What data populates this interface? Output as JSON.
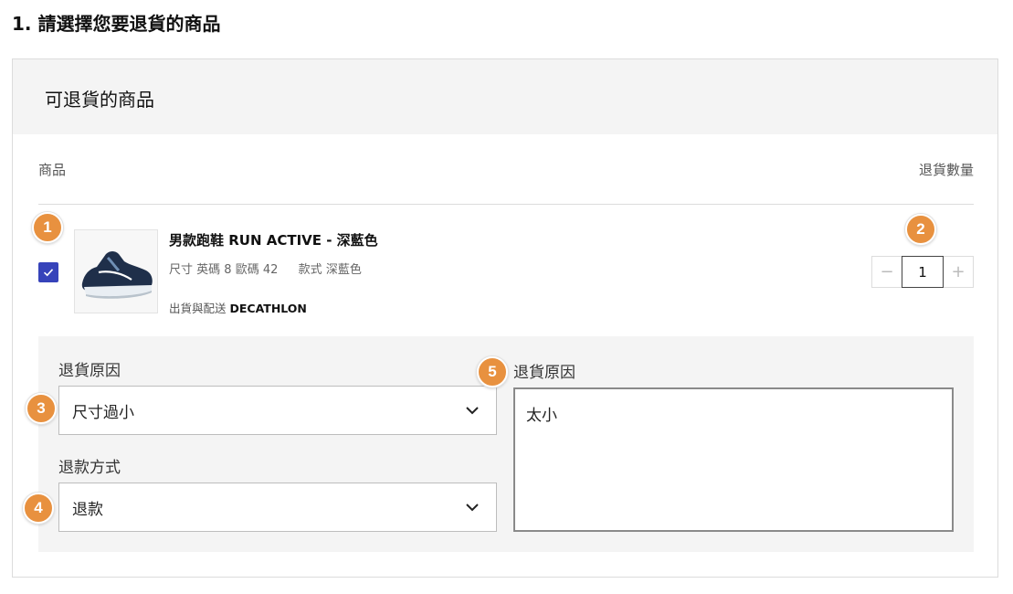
{
  "page": {
    "step_title": "1. 請選擇您要退貨的商品"
  },
  "card": {
    "title": "可退貨的商品",
    "column_product": "商品",
    "column_quantity": "退貨數量"
  },
  "item": {
    "checked": true,
    "name": "男款跑鞋 RUN ACTIVE - 深藍色",
    "size_label": "尺寸",
    "size_value": "英碼 8 歐碼 42",
    "style_label": "款式",
    "style_value": "深藍色",
    "seller_label": "出貨與配送",
    "seller_value": "DECATHLON",
    "image_icon": "running-shoe-image"
  },
  "quantity": {
    "minus": "−",
    "value": "1",
    "plus": "+"
  },
  "reason": {
    "label": "退貨原因",
    "selected": "尺寸過小"
  },
  "refund": {
    "label": "退款方式",
    "selected": "退款"
  },
  "comment": {
    "label": "退貨原因",
    "value": "太小"
  },
  "badges": [
    "1",
    "2",
    "3",
    "4",
    "5"
  ],
  "colors": {
    "checkbox": "#3643ba",
    "badge": "#e8913f",
    "header_bg": "#f4f4f4"
  }
}
